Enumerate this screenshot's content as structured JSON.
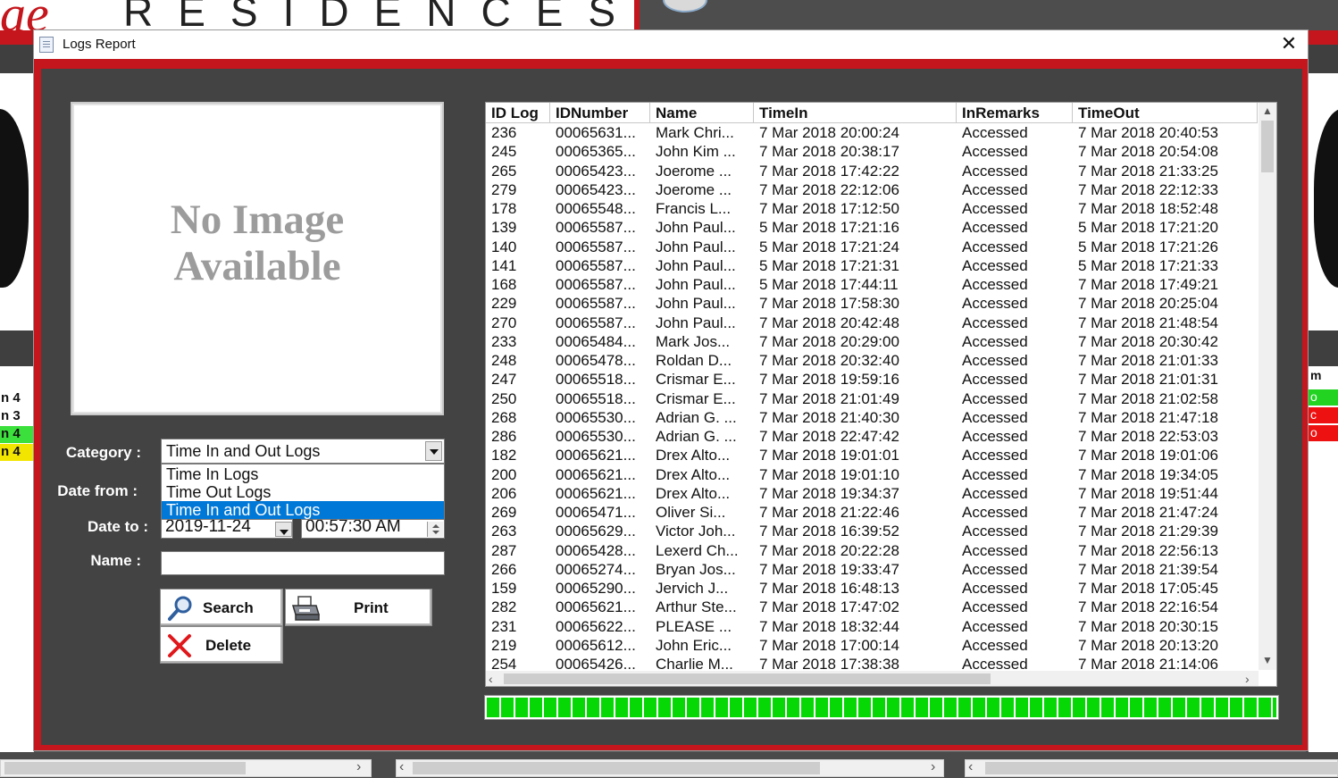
{
  "background_app": {
    "brand_text": "RESIDENCES",
    "left_list": [
      "n 4",
      "n 3",
      "n 4",
      "n 4"
    ],
    "right_header": "m",
    "right_list": [
      "o",
      "c",
      "o"
    ]
  },
  "dialog": {
    "title": "Logs Report",
    "close_glyph": "✕"
  },
  "photo": {
    "placeholder_line1": "No Image",
    "placeholder_line2": "Available"
  },
  "form": {
    "category_label": "Category :",
    "date_from_label": "Date from :",
    "date_to_label": "Date to :",
    "name_label": "Name :",
    "category_value": "Time In and Out Logs",
    "category_options": [
      "Time In Logs",
      "Time Out Logs",
      "Time In and Out Logs"
    ],
    "category_selected_index": 2,
    "date_to_value": "2019-11-24",
    "time_to_value": "00:57:30 AM",
    "name_value": ""
  },
  "buttons": {
    "search": "Search",
    "print": "Print",
    "delete": "Delete"
  },
  "colors": {
    "accent_red": "#c4161c",
    "panel_dark": "#434343",
    "progress_green": "#06d806",
    "selection_blue": "#0078d7"
  },
  "grid": {
    "columns": [
      "ID Log",
      "IDNumber",
      "Name",
      "TimeIn",
      "InRemarks",
      "TimeOut"
    ],
    "rows": [
      [
        "236",
        "00065631...",
        "Mark Chri...",
        "7 Mar 2018 20:00:24",
        "Accessed",
        "7 Mar 2018 20:40:53"
      ],
      [
        "245",
        "00065365...",
        "John Kim ...",
        "7 Mar 2018 20:38:17",
        "Accessed",
        "7 Mar 2018 20:54:08"
      ],
      [
        "265",
        "00065423...",
        "Joerome ...",
        "7 Mar 2018 17:42:22",
        "Accessed",
        "7 Mar 2018 21:33:25"
      ],
      [
        "279",
        "00065423...",
        "Joerome ...",
        "7 Mar 2018 22:12:06",
        "Accessed",
        "7 Mar 2018 22:12:33"
      ],
      [
        "178",
        "00065548...",
        "Francis L...",
        "7 Mar 2018 17:12:50",
        "Accessed",
        "7 Mar 2018 18:52:48"
      ],
      [
        "139",
        "00065587...",
        "John Paul...",
        "5 Mar 2018 17:21:16",
        "Accessed",
        "5 Mar 2018 17:21:20"
      ],
      [
        "140",
        "00065587...",
        "John Paul...",
        "5 Mar 2018 17:21:24",
        "Accessed",
        "5 Mar 2018 17:21:26"
      ],
      [
        "141",
        "00065587...",
        "John Paul...",
        "5 Mar 2018 17:21:31",
        "Accessed",
        "5 Mar 2018 17:21:33"
      ],
      [
        "168",
        "00065587...",
        "John Paul...",
        "5 Mar 2018 17:44:11",
        "Accessed",
        "7 Mar 2018 17:49:21"
      ],
      [
        "229",
        "00065587...",
        "John Paul...",
        "7 Mar 2018 17:58:30",
        "Accessed",
        "7 Mar 2018 20:25:04"
      ],
      [
        "270",
        "00065587...",
        "John Paul...",
        "7 Mar 2018 20:42:48",
        "Accessed",
        "7 Mar 2018 21:48:54"
      ],
      [
        "233",
        "00065484...",
        "Mark Jos...",
        "7 Mar 2018 20:29:00",
        "Accessed",
        "7 Mar 2018 20:30:42"
      ],
      [
        "248",
        "00065478...",
        "Roldan D...",
        "7 Mar 2018 20:32:40",
        "Accessed",
        "7 Mar 2018 21:01:33"
      ],
      [
        "247",
        "00065518...",
        "Crismar E...",
        "7 Mar 2018 19:59:16",
        "Accessed",
        "7 Mar 2018 21:01:31"
      ],
      [
        "250",
        "00065518...",
        "Crismar E...",
        "7 Mar 2018 21:01:49",
        "Accessed",
        "7 Mar 2018 21:02:58"
      ],
      [
        "268",
        "00065530...",
        "Adrian G. ...",
        "7 Mar 2018 21:40:30",
        "Accessed",
        "7 Mar 2018 21:47:18"
      ],
      [
        "286",
        "00065530...",
        "Adrian G. ...",
        "7 Mar 2018 22:47:42",
        "Accessed",
        "7 Mar 2018 22:53:03"
      ],
      [
        "182",
        "00065621...",
        "Drex Alto...",
        "7 Mar 2018 19:01:01",
        "Accessed",
        "7 Mar 2018 19:01:06"
      ],
      [
        "200",
        "00065621...",
        "Drex Alto...",
        "7 Mar 2018 19:01:10",
        "Accessed",
        "7 Mar 2018 19:34:05"
      ],
      [
        "206",
        "00065621...",
        "Drex Alto...",
        "7 Mar 2018 19:34:37",
        "Accessed",
        "7 Mar 2018 19:51:44"
      ],
      [
        "269",
        "00065471...",
        "Oliver Si...",
        "7 Mar 2018 21:22:46",
        "Accessed",
        "7 Mar 2018 21:47:24"
      ],
      [
        "263",
        "00065629...",
        "Victor Joh...",
        "7 Mar 2018 16:39:52",
        "Accessed",
        "7 Mar 2018 21:29:39"
      ],
      [
        "287",
        "00065428...",
        "Lexerd Ch...",
        "7 Mar 2018 20:22:28",
        "Accessed",
        "7 Mar 2018 22:56:13"
      ],
      [
        "266",
        "00065274...",
        "Bryan Jos...",
        "7 Mar 2018 19:33:47",
        "Accessed",
        "7 Mar 2018 21:39:54"
      ],
      [
        "159",
        "00065290...",
        "Jervich J...",
        "7 Mar 2018 16:48:13",
        "Accessed",
        "7 Mar 2018 17:05:45"
      ],
      [
        "282",
        "00065621...",
        "Arthur Ste...",
        "7 Mar 2018 17:47:02",
        "Accessed",
        "7 Mar 2018 22:16:54"
      ],
      [
        "231",
        "00065622...",
        "PLEASE ...",
        "7 Mar 2018 18:32:44",
        "Accessed",
        "7 Mar 2018 20:30:15"
      ],
      [
        "219",
        "00065612...",
        "John Eric...",
        "7 Mar 2018 17:00:14",
        "Accessed",
        "7 Mar 2018 20:13:20"
      ],
      [
        "254",
        "00065426...",
        "Charlie M...",
        "7 Mar 2018 17:38:38",
        "Accessed",
        "7 Mar 2018 21:14:06"
      ]
    ]
  },
  "progress": {
    "percent": 100
  }
}
